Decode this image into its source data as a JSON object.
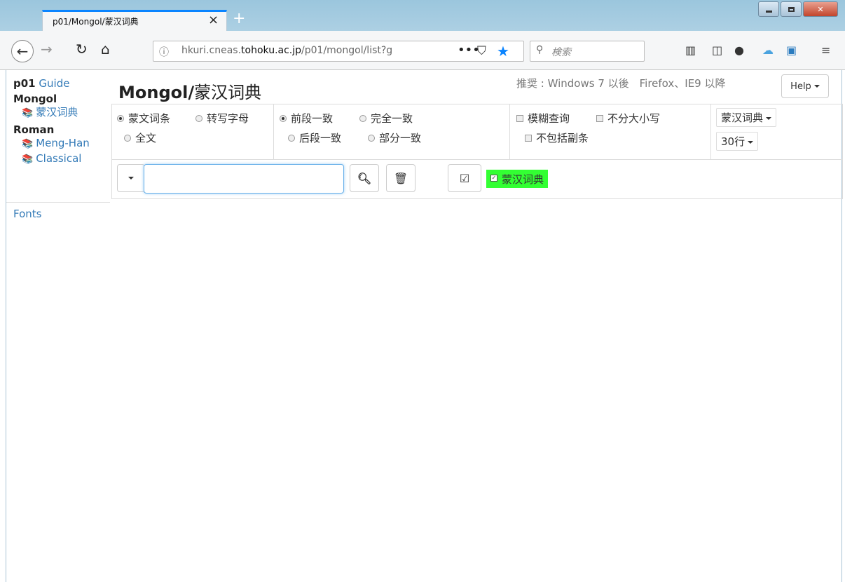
{
  "browser": {
    "tab_title": "p01/Mongol/蒙汉词典",
    "tab_close": "×",
    "new_tab": "+",
    "url_host_pre": "hkuri.cneas.",
    "url_host_bold": "tohoku.ac.jp",
    "url_path": "/p01/mongol/list?g",
    "url_more": "•••",
    "search_placeholder": "検索"
  },
  "sidebar": {
    "p01": "p01",
    "guide": "Guide",
    "section_mongol": "Mongol",
    "item_menghan_dict": "蒙汉词典",
    "section_roman": "Roman",
    "item_meng_han": "Meng-Han",
    "item_classical": "Classical",
    "fonts": "Fonts"
  },
  "header": {
    "title_mn": "Mongol/",
    "title_cn": "蒙汉词典",
    "recommend": "推奨 : Windows 7 以後　Firefox、IE9 以降",
    "help": "Help"
  },
  "options": {
    "field": {
      "mongolian_entry": "蒙文词条",
      "transliteration": "转写字母",
      "fulltext": "全文",
      "selected": "mongolian_entry"
    },
    "match": {
      "prefix": "前段一致",
      "exact": "完全一致",
      "suffix": "后段一致",
      "partial": "部分一致",
      "selected": "prefix"
    },
    "flags": {
      "fuzzy": "模糊查询",
      "case_insensitive": "不分大小写",
      "exclude_subentries": "不包括副条"
    },
    "dictionary_select": "蒙汉词典",
    "rows_select": "30行"
  },
  "search": {
    "query_value": "",
    "selected_dict": "蒙汉词典"
  },
  "colors": {
    "link": "#337ab7",
    "dict_badge_bg": "#33ff33",
    "input_focus": "#66afe9"
  }
}
